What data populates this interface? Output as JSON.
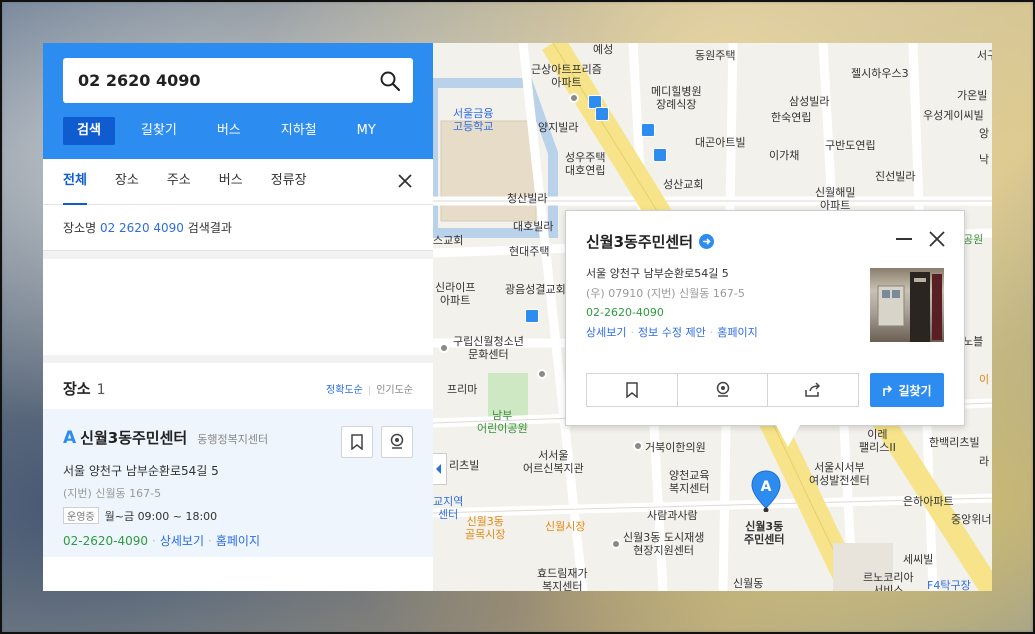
{
  "search": {
    "query": "02 2620 4090"
  },
  "main_tabs": [
    "검색",
    "길찾기",
    "버스",
    "지하철",
    "MY"
  ],
  "sub_tabs": [
    "전체",
    "장소",
    "주소",
    "버스",
    "정류장"
  ],
  "result_line": {
    "prefix": "장소명",
    "query": "02 2620 4090",
    "suffix": "검색결과"
  },
  "section": {
    "title": "장소",
    "count": "1",
    "sort_accuracy": "정확도순",
    "sort_popular": "인기도순"
  },
  "place": {
    "letter": "A",
    "name": "신월3동주민센터",
    "category": "동행정복지센터",
    "address": "서울 양천구 남부순환로54길 5",
    "lot_address": "(지번) 신월동 167-5",
    "status": "운영중",
    "hours": "월~금 09:00 ~ 18:00",
    "phone": "02-2620-4090",
    "link_detail": "상세보기",
    "link_homepage": "홈페이지"
  },
  "popup": {
    "title": "신월3동주민센터",
    "address": "서울 양천구 남부순환로54길 5",
    "lot_address": "(우) 07910  (지번) 신월동 167-5",
    "phone": "02-2620-4090",
    "link_detail": "상세보기",
    "link_edit": "정보 수정 제안",
    "link_homepage": "홈페이지",
    "route_label": "길찾기"
  },
  "marker": {
    "letter": "A",
    "label": "신월3동\n주민센터"
  },
  "map_labels": [
    {
      "t": "예성",
      "c": ""
    },
    {
      "t": "동원주택",
      "c": ""
    },
    {
      "t": "근상아트프리즘\n아파트",
      "c": ""
    },
    {
      "t": "메디힐병원\n장례식장",
      "c": ""
    },
    {
      "t": "서울금융\n고등학교",
      "c": "blue"
    },
    {
      "t": "양지빌라",
      "c": ""
    },
    {
      "t": "성우주택\n대호연립",
      "c": ""
    },
    {
      "t": "대곤아트빌",
      "c": ""
    },
    {
      "t": "성산교회",
      "c": ""
    },
    {
      "t": "청산빌라",
      "c": ""
    },
    {
      "t": "대호빌라",
      "c": ""
    },
    {
      "t": "현대주택",
      "c": ""
    },
    {
      "t": "광음성결교회",
      "c": ""
    },
    {
      "t": "신라이프\n아파트",
      "c": ""
    },
    {
      "t": "구립신월청소년\n문화센터",
      "c": ""
    },
    {
      "t": "프리마",
      "c": ""
    },
    {
      "t": "남부\n어린이공원",
      "c": "green"
    },
    {
      "t": "서서울\n어르신복지관",
      "c": ""
    },
    {
      "t": "거북이한의원",
      "c": ""
    },
    {
      "t": "양천교육\n복지센터",
      "c": ""
    },
    {
      "t": "사람과사람",
      "c": ""
    },
    {
      "t": "신월시장",
      "c": "orange"
    },
    {
      "t": "신월3동\n골목시장",
      "c": "orange"
    },
    {
      "t": "신월3동 도시재생\n현장지원센터",
      "c": ""
    },
    {
      "t": "효드림재가\n복지센터",
      "c": ""
    },
    {
      "t": "신월동",
      "c": ""
    },
    {
      "t": "젤시하우스3",
      "c": ""
    },
    {
      "t": "삼성빌라",
      "c": ""
    },
    {
      "t": "한숙연립",
      "c": ""
    },
    {
      "t": "이가채",
      "c": ""
    },
    {
      "t": "구반도연립",
      "c": ""
    },
    {
      "t": "진선빌라",
      "c": ""
    },
    {
      "t": "신월해밀\n아파트",
      "c": ""
    },
    {
      "t": "가온빌",
      "c": ""
    },
    {
      "t": "우성게이씨빌",
      "c": ""
    },
    {
      "t": "이레\n팰리스II",
      "c": ""
    },
    {
      "t": "한백리츠빌",
      "c": ""
    },
    {
      "t": "서울시서부\n여성발전센터",
      "c": ""
    },
    {
      "t": "은하아파트",
      "c": ""
    },
    {
      "t": "중앙위너",
      "c": ""
    },
    {
      "t": "르노코리아\n서비스",
      "c": ""
    },
    {
      "t": "F4탁구장",
      "c": "blue"
    },
    {
      "t": "리츠빌",
      "c": ""
    },
    {
      "t": "스교회",
      "c": ""
    },
    {
      "t": "공원",
      "c": "green"
    },
    {
      "t": "노블",
      "c": ""
    },
    {
      "t": "서구",
      "c": ""
    },
    {
      "t": "교지역\n센터",
      "c": "blue"
    },
    {
      "t": "라",
      "c": ""
    },
    {
      "t": "이",
      "c": "orange"
    },
    {
      "t": "앙",
      "c": ""
    },
    {
      "t": "낙",
      "c": ""
    },
    {
      "t": "세씨빌",
      "c": ""
    }
  ],
  "colors": {
    "brand_blue": "#2d8cf0",
    "tab_active": "#0f5bd0",
    "phone_green": "#2e9b3e",
    "road_yellow": "#f7e48a"
  }
}
